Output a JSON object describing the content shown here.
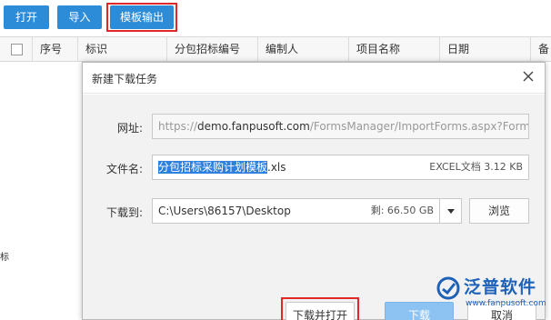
{
  "toolbar": {
    "open_label": "打开",
    "import_label": "导入",
    "export_template_label": "模板输出"
  },
  "table": {
    "columns": [
      "序号",
      "标识",
      "分包招标编号",
      "编制人",
      "项目名称",
      "日期",
      "备"
    ]
  },
  "left_edge_char": "标",
  "dialog": {
    "title": "新建下载任务",
    "url_label": "网址:",
    "url_prefix": "https://",
    "url_host": "demo.fanpusoft.com",
    "url_path": "/FormsManager/ImportForms.aspx?Formi",
    "filename_label": "文件名:",
    "filename_selected": "分包招标采购计划模板",
    "filename_ext": ".xls",
    "file_info": "EXCEL文档 3.12 KB",
    "saveto_label": "下载到:",
    "save_path": "C:\\Users\\86157\\Desktop",
    "free_space": "剩: 66.50 GB",
    "browse_label": "浏览",
    "download_open_label": "下载并打开",
    "download_label": "下载",
    "cancel_label": "取消"
  },
  "watermark": {
    "brand": "泛普软件",
    "url": "www.fanpusoft.com"
  },
  "colors": {
    "toolbar_button": "#2d8cd8",
    "highlight_border": "#e02828",
    "download_button": "#8dc3f3",
    "selection": "#2d7fe0",
    "logo": "#1e62b8"
  }
}
